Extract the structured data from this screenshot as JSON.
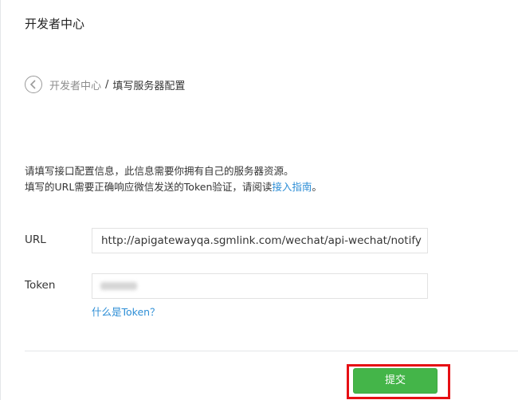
{
  "header": {
    "title": "开发者中心"
  },
  "breadcrumb": {
    "back_icon": "chevron-left-circle-icon",
    "parent": "开发者中心",
    "separator": "/",
    "current": "填写服务器配置"
  },
  "intro": {
    "line1": "请填写接口配置信息，此信息需要你拥有自己的服务器资源。",
    "line2_prefix": "填写的URL需要正确响应微信发送的Token验证，请阅读",
    "line2_link": "接入指南",
    "line2_suffix": "。"
  },
  "form": {
    "url": {
      "label": "URL",
      "value": "http://apigatewayqa.sgmlink.com/wechat/api-wechat/notify"
    },
    "token": {
      "label": "Token",
      "value": "",
      "redacted": true
    },
    "token_help_link": "什么是Token？"
  },
  "actions": {
    "submit_label": "提交",
    "submit_color": "#44b549",
    "highlight_color": "#e60f14"
  }
}
